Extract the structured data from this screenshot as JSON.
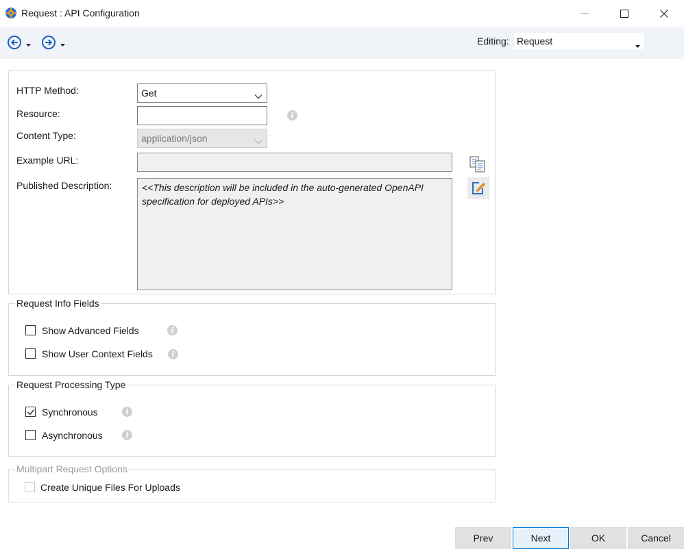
{
  "window": {
    "title": "Request : API Configuration"
  },
  "toolbar": {
    "editing_label": "Editing:",
    "editing_value": "Request"
  },
  "form": {
    "http_method_label": "HTTP Method:",
    "http_method_value": "Get",
    "resource_label": "Resource:",
    "resource_value": "",
    "content_type_label": "Content Type:",
    "content_type_value": "application/json",
    "example_url_label": "Example URL:",
    "example_url_value": "",
    "published_description_label": "Published Description:",
    "published_description_value": "<<This description will be included in the auto-generated OpenAPI specification for deployed APIs>>"
  },
  "request_info": {
    "title": "Request Info Fields",
    "show_advanced_label": "Show Advanced Fields",
    "show_advanced_checked": false,
    "show_user_context_label": "Show User Context Fields",
    "show_user_context_checked": false
  },
  "processing": {
    "title": "Request Processing Type",
    "synchronous_label": "Synchronous",
    "synchronous_checked": true,
    "asynchronous_label": "Asynchronous",
    "asynchronous_checked": false
  },
  "multipart": {
    "title": "Multipart Request Options",
    "unique_files_label": "Create Unique Files For Uploads",
    "unique_files_checked": false
  },
  "buttons": {
    "prev": "Prev",
    "next": "Next",
    "ok": "OK",
    "cancel": "Cancel"
  },
  "colors": {
    "accent": "#1f5fbf",
    "toolbar_bg": "#f0f3f8",
    "icon_orange": "#e8781e"
  }
}
